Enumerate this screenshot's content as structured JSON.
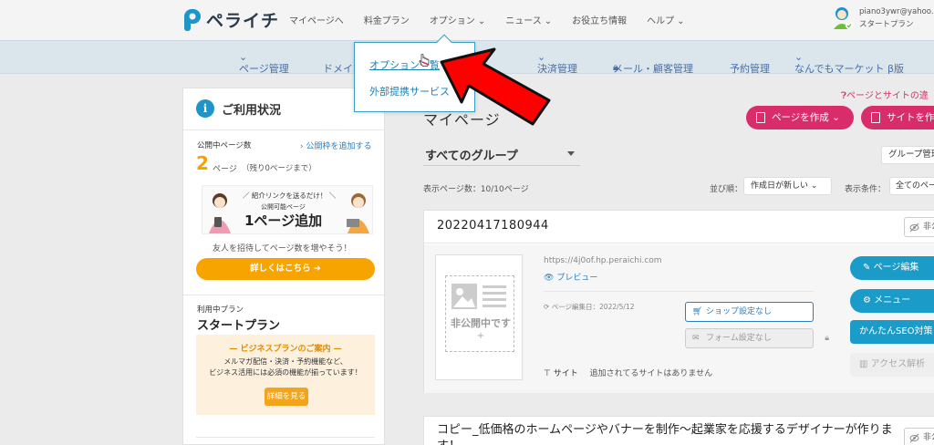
{
  "header": {
    "logo_text": "ペライチ",
    "nav": [
      {
        "label": "マイページへ",
        "caret": false
      },
      {
        "label": "料金プラン",
        "caret": false
      },
      {
        "label": "オプション",
        "caret": true
      },
      {
        "label": "ニュース",
        "caret": true
      },
      {
        "label": "お役立ち情報",
        "caret": false
      },
      {
        "label": "ヘルプ",
        "caret": true
      }
    ],
    "user_email": "piano3ywr@yahoo.",
    "user_plan": "スタートプラン"
  },
  "subnav": {
    "items": [
      "ページ管理",
      "ドメイ",
      "決済管理",
      "メール・顧客管理",
      "予約管理",
      "なんでもマーケット β版"
    ]
  },
  "dropdown": {
    "items": [
      "オプション一覧",
      "外部提携サービス"
    ]
  },
  "sidebar": {
    "title": "ご利用状況",
    "pub_label": "公開中ページ数",
    "pub_add": "公開枠を追加する",
    "page_count": "2",
    "page_unit": "ページ",
    "remaining": "（残り0ページまで）",
    "banner_top": "紹介リンクを送るだけ！",
    "banner_mid": "公開可能ページ",
    "banner_big": "1ページ追加",
    "invite_text": "友人を招待してページ数を増やそう！",
    "detail_button": "詳しくはこちら ➜",
    "plan_label": "利用中プラン",
    "plan_name": "スタートプラン",
    "biz_title": "— ビジネスプランのご案内 —",
    "biz_text_1": "メルマガ配信・決済・予約機能など、",
    "biz_text_2": "ビジネス活用には必須の機能が揃っています！",
    "biz_button": "詳細を見る"
  },
  "main": {
    "help_link": "ページとサイトの違",
    "title": "マイページ",
    "create_page_button": "ページを作成",
    "create_site_button": "サイトを作",
    "group_select": "すべてのグループ",
    "group_manage": "グループ管理",
    "count_text": "表示ページ数：10/10ページ",
    "sort_label": "並び順：",
    "sort_value": "作成日が新しい",
    "filter_label": "表示条件：",
    "filter_value": "全てのペー"
  },
  "card": {
    "title": "20220417180944",
    "private_badge": "非公",
    "thumb_text": "非公開中です",
    "thumb_plus": "+",
    "url": "https://4j0of.hp.peraichi.com",
    "preview": "プレビュー",
    "edit_date": "ページ編集日：2022/5/12",
    "shop_button": "ショップ設定なし",
    "form_button": "フォーム設定なし",
    "site_label": "サイト",
    "site_text": "追加されてるサイトはありません",
    "edit_button": "ページ編集",
    "menu_button": "メニュー",
    "seo_button": "かんたんSEO対策",
    "analytics_button": "アクセス解析"
  },
  "card2": {
    "title": "コピー_低価格のホームページやバナーを制作～起業家を応援するデザイナーが作ります！",
    "private_badge": "非公"
  },
  "colors": {
    "accent_blue": "#1b9cc8",
    "pink": "#d92c6b",
    "orange": "#f7a400",
    "red_arrow": "#ff0000"
  }
}
